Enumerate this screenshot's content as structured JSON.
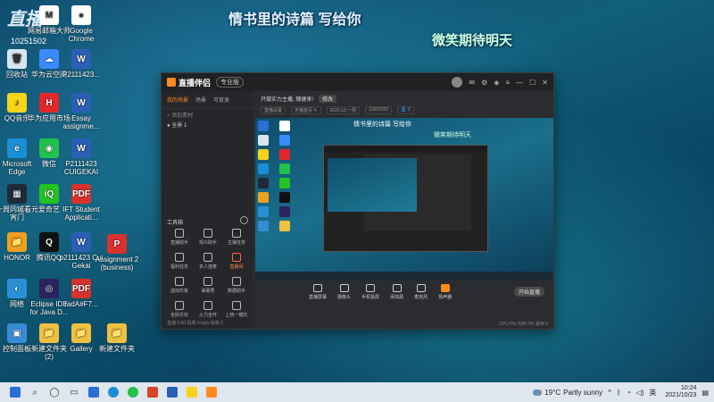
{
  "desktop": {
    "logo": "直播",
    "logo_num": "10251502",
    "banner1": "情书里的诗篇 写给你",
    "banner2": "微笑期待明天",
    "icons": [
      {
        "label": "",
        "color": "#2b6fd6",
        "glyph": ""
      },
      {
        "label": "网易邮箱大师",
        "color": "#ffffff",
        "glyph": "M"
      },
      {
        "label": "Google Chrome",
        "color": "#ffffff",
        "glyph": "●"
      },
      {
        "label": "回收站",
        "color": "#d9e6f2",
        "glyph": "🗑"
      },
      {
        "label": "华为云空间",
        "color": "#3a8bff",
        "glyph": "☁"
      },
      {
        "label": "P2111423...",
        "color": "#2b5fb3",
        "glyph": "W"
      },
      {
        "label": "QQ音乐",
        "color": "#f7d31a",
        "glyph": "♪"
      },
      {
        "label": "华为应用市场",
        "color": "#e3262c",
        "glyph": "H"
      },
      {
        "label": "Essay assignme...",
        "color": "#2b5fb3",
        "glyph": "W"
      },
      {
        "label": "Microsoft Edge",
        "color": "#1a8fd6",
        "glyph": "e"
      },
      {
        "label": "微信",
        "color": "#21c14b",
        "glyph": "◉"
      },
      {
        "label": "P2111423 CUIGEKAI",
        "color": "#2b5fb3",
        "glyph": "W"
      },
      {
        "label": "一周同城看元宵门",
        "color": "#1e2a3a",
        "glyph": "▦"
      },
      {
        "label": "爱奇艺",
        "color": "#22c322",
        "glyph": "iQ"
      },
      {
        "label": "IFT Student Applicati...",
        "color": "#d9322c",
        "glyph": "PDF"
      },
      {
        "label": "HONOR",
        "color": "#f0a020",
        "glyph": "📁"
      },
      {
        "label": "腾讯QQ",
        "color": "#111",
        "glyph": "Q"
      },
      {
        "label": "p2111423 Cui Gekai",
        "color": "#2b5fb3",
        "glyph": "W"
      },
      {
        "label": "Assignment 2 (business)",
        "color": "#d9322c",
        "glyph": "P"
      },
      {
        "label": "网络",
        "color": "#2a90d6",
        "glyph": "◐"
      },
      {
        "label": "Eclipse IDE for Java D...",
        "color": "#2c2260",
        "glyph": "◎"
      },
      {
        "label": "radA#F7...",
        "color": "#d9322c",
        "glyph": "PDF"
      },
      {
        "label": "控制面板",
        "color": "#3a8bd6",
        "glyph": "▣"
      },
      {
        "label": "新建文件夹 (2)",
        "color": "#f0c040",
        "glyph": "📁"
      },
      {
        "label": "Gallery",
        "color": "#f0c040",
        "glyph": "📁"
      },
      {
        "label": "新建文件夹",
        "color": "#f0c040",
        "glyph": "📁"
      }
    ]
  },
  "app": {
    "title": "直播伴侣",
    "badge": "专业版",
    "tabs": [
      "我的场景",
      "场景",
      "可首发"
    ],
    "add_source": "+ 添加素材",
    "scene_item": "● 全景 1",
    "tools_title": "工具箱",
    "tools": [
      {
        "label": "直播助手",
        "red": false
      },
      {
        "label": "观众助手",
        "red": false
      },
      {
        "label": "主播任务",
        "red": false
      },
      {
        "label": "福利任务",
        "red": false
      },
      {
        "label": "多人连麦",
        "red": false
      },
      {
        "label": "直播间",
        "red": true
      },
      {
        "label": "虚拟形象",
        "red": false
      },
      {
        "label": "弹幕秀",
        "red": false
      },
      {
        "label": "数据助手",
        "red": false
      },
      {
        "label": "全民乐玩",
        "red": false
      },
      {
        "label": "火力全开",
        "red": false
      },
      {
        "label": "上热一键托",
        "red": false
      }
    ],
    "prompt": "只做实力主播, 随便来!",
    "prompt_pill": "修改",
    "meta": [
      "直播设置",
      "天猫首页 ✎",
      "2020.10.一周",
      "10251502",
      "👤 0"
    ],
    "preview_text1": "情书里的诗篇 写给你",
    "preview_text2": "微笑期待明天",
    "controls": [
      {
        "label": "直播屏幕",
        "orange": false
      },
      {
        "label": "摄像头",
        "orange": false
      },
      {
        "label": "手机投屏",
        "orange": false
      },
      {
        "label": "添加源",
        "orange": false
      },
      {
        "label": "麦克风",
        "orange": false
      },
      {
        "label": "扬声器",
        "orange": true
      }
    ],
    "start_live": "开始直播",
    "status_left": "直播 0:00  码率 0 kb/s  帧率 0",
    "status_right": "CPU 0%  内存 0%  丢帧 0"
  },
  "taskbar": {
    "weather_temp": "19°C",
    "weather_desc": "Partly sunny",
    "time": "10:24",
    "date": "2021/10/23",
    "lang": "英"
  },
  "colors": {
    "accent": "#ff8a1f",
    "window_bg": "#262729",
    "taskbar_bg": "#dfe6ee"
  }
}
